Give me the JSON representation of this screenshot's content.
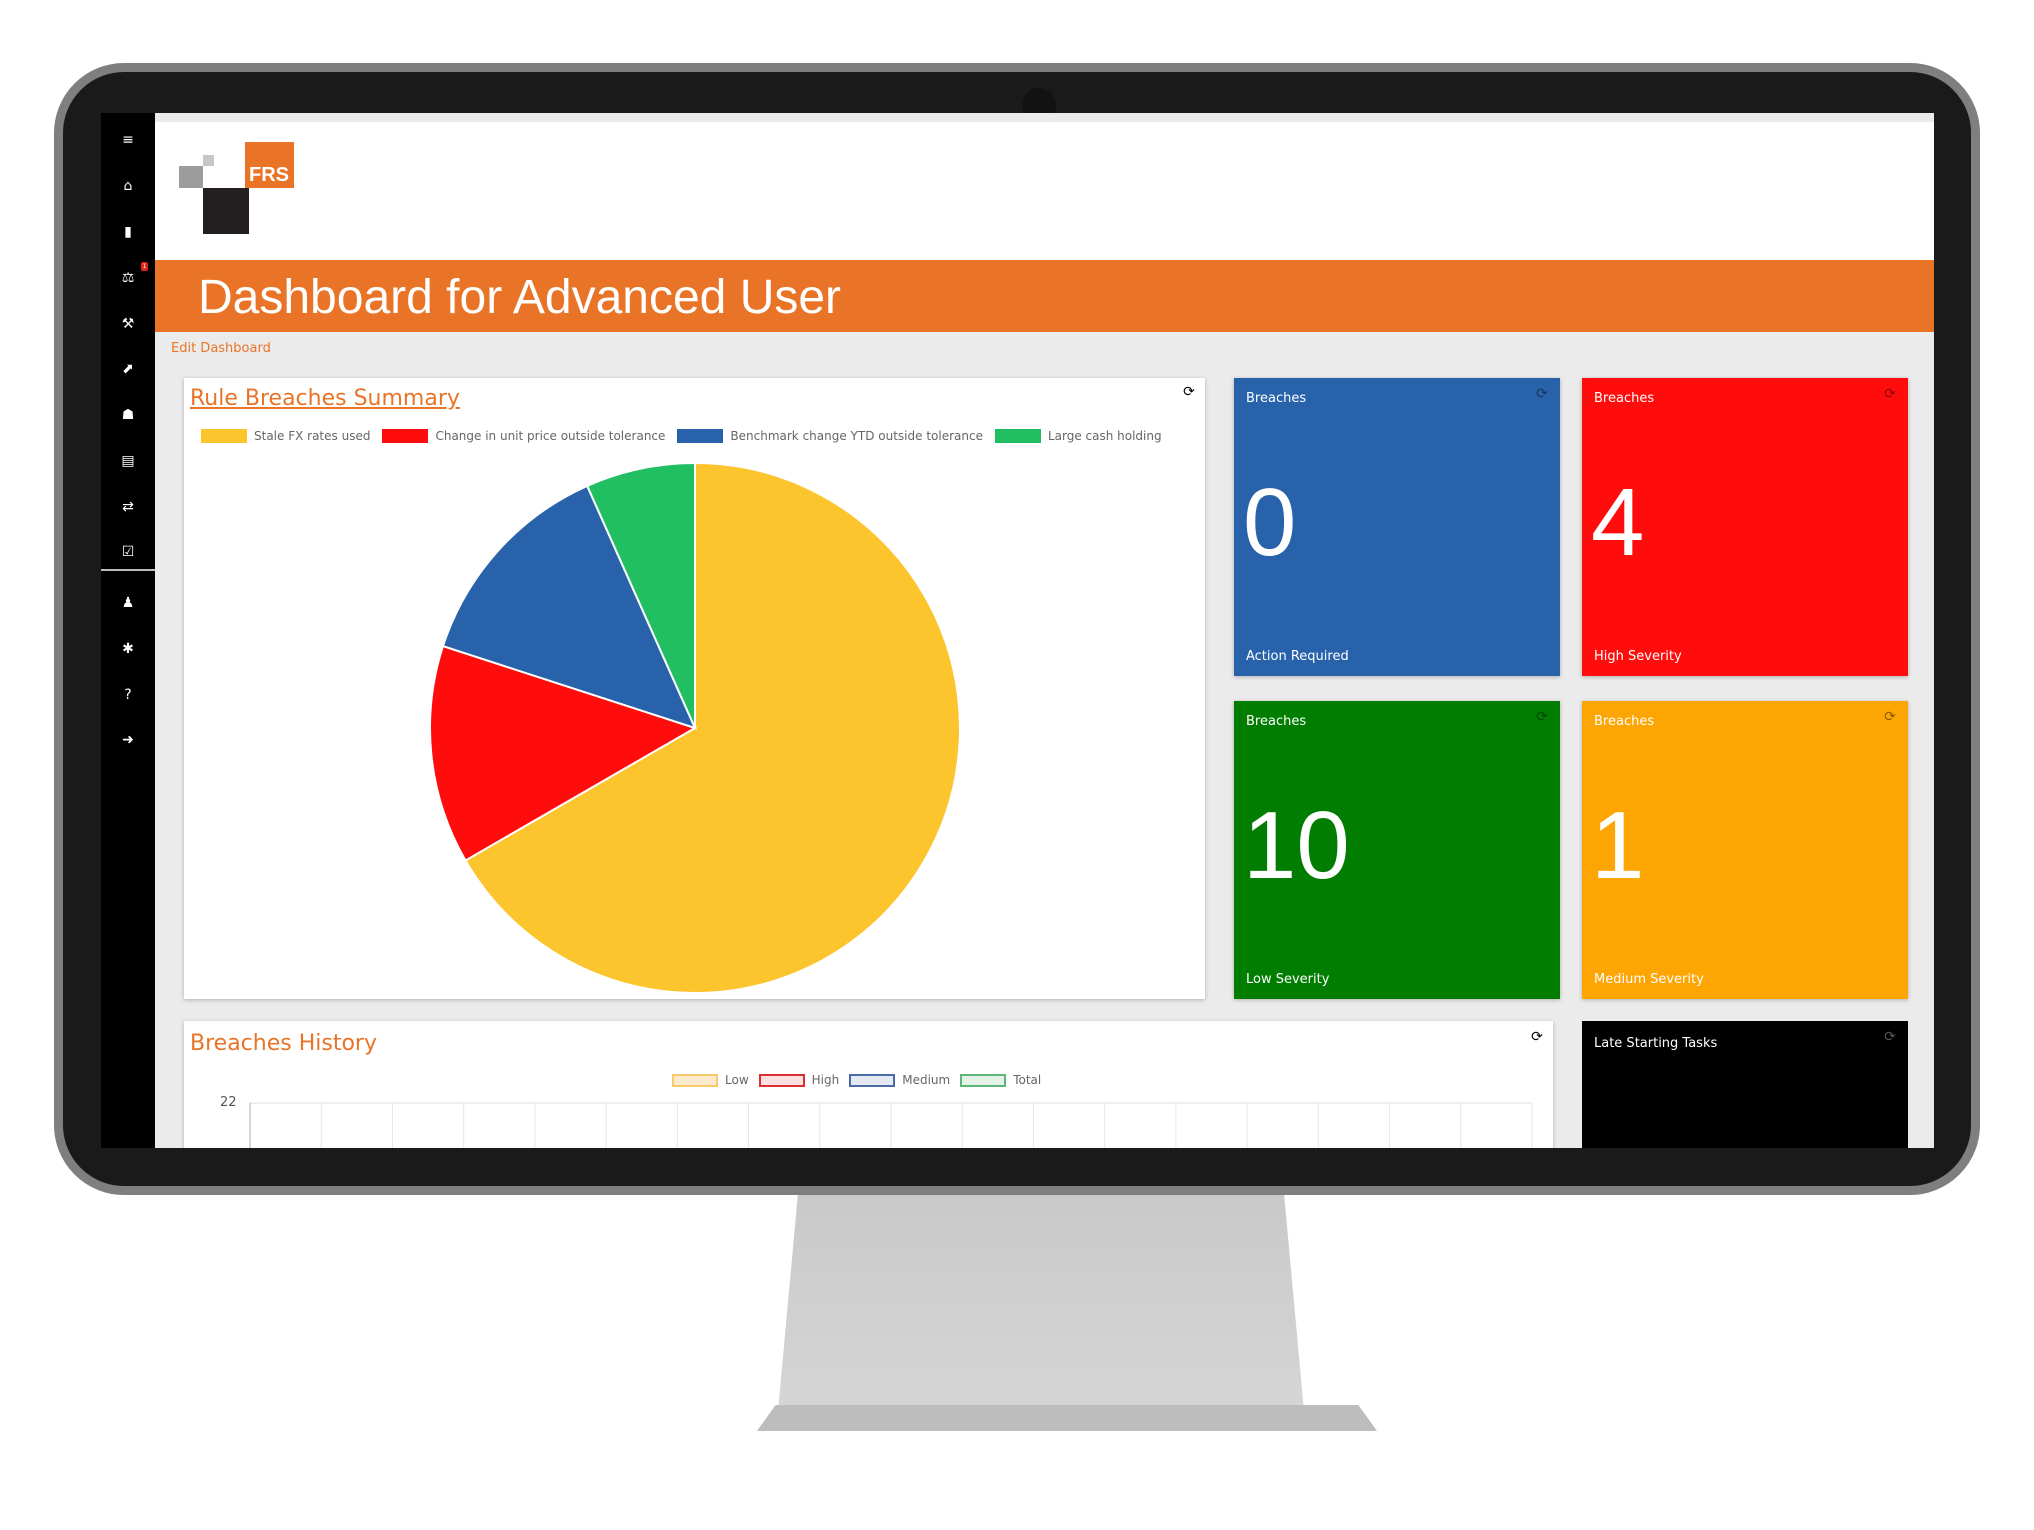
{
  "header": {
    "logo_text": "FRS",
    "title": "Dashboard for Advanced User",
    "edit_link": "Edit Dashboard"
  },
  "sidebar": {
    "items": [
      {
        "icon": "menu-icon",
        "glyph": "≡"
      },
      {
        "icon": "home-icon",
        "glyph": "⌂"
      },
      {
        "icon": "document-icon",
        "glyph": "▮"
      },
      {
        "icon": "scale-icon",
        "glyph": "⚖",
        "badge": "1"
      },
      {
        "icon": "gavel-icon",
        "glyph": "⚒"
      },
      {
        "icon": "line-chart-icon",
        "glyph": "⬈"
      },
      {
        "icon": "users-icon",
        "glyph": "☗"
      },
      {
        "icon": "card-icon",
        "glyph": "▤"
      },
      {
        "icon": "exchange-icon",
        "glyph": "⇄"
      },
      {
        "icon": "checkbox-icon",
        "glyph": "☑"
      },
      {
        "icon": "user-icon",
        "glyph": "♟"
      },
      {
        "icon": "cog-icon",
        "glyph": "✱"
      },
      {
        "icon": "help-icon",
        "glyph": "?"
      },
      {
        "icon": "sign-out-icon",
        "glyph": "➜"
      }
    ]
  },
  "pie_panel": {
    "title": "Rule Breaches Summary",
    "legend": [
      {
        "label": "Stale FX rates used",
        "color": "#fcc42d"
      },
      {
        "label": "Change in unit price outside tolerance",
        "color": "#ff0d0d"
      },
      {
        "label": "Benchmark change YTD outside tolerance",
        "color": "#2762aa"
      },
      {
        "label": "Large cash holding",
        "color": "#21bf61"
      }
    ]
  },
  "chart_data": [
    {
      "type": "pie",
      "title": "Rule Breaches Summary",
      "categories": [
        "Stale FX rates used",
        "Change in unit price outside tolerance",
        "Benchmark change YTD outside tolerance",
        "Large cash holding"
      ],
      "values": [
        10,
        2,
        2,
        1
      ],
      "colors": [
        "#fcc42d",
        "#ff0d0d",
        "#2762aa",
        "#21bf61"
      ],
      "legend": "top"
    },
    {
      "type": "line",
      "title": "Breaches History",
      "series": [
        {
          "name": "Low",
          "color": "#f5d6a2"
        },
        {
          "name": "High",
          "color": "#e46161"
        },
        {
          "name": "Medium",
          "color": "#8ea1c4"
        },
        {
          "name": "Total",
          "color": "#9ed5ae"
        }
      ],
      "y_ticks": [
        "22"
      ],
      "grid": true,
      "legend": "top"
    }
  ],
  "tiles": [
    {
      "id": "action",
      "heading": "Breaches",
      "value": "0",
      "caption": "Action Required",
      "color": "#2762aa"
    },
    {
      "id": "high",
      "heading": "Breaches",
      "value": "4",
      "caption": "High Severity",
      "color": "#ff0d0d"
    },
    {
      "id": "low",
      "heading": "Breaches",
      "value": "10",
      "caption": "Low Severity",
      "color": "#017e01"
    },
    {
      "id": "medium",
      "heading": "Breaches",
      "value": "1",
      "caption": "Medium Severity",
      "color": "#fda503"
    }
  ],
  "history_panel": {
    "title": "Breaches History",
    "legend": [
      {
        "label": "Low",
        "fill": "#fbeacb",
        "border": "#f5c96c"
      },
      {
        "label": "High",
        "fill": "#fbe1e1",
        "border": "#d9312f"
      },
      {
        "label": "Medium",
        "fill": "#e5e9f1",
        "border": "#4b6aa8"
      },
      {
        "label": "Total",
        "fill": "#e4f2e8",
        "border": "#5cb67a"
      }
    ],
    "y_tick": "22"
  },
  "late_tasks": {
    "label": "Late Starting Tasks"
  }
}
